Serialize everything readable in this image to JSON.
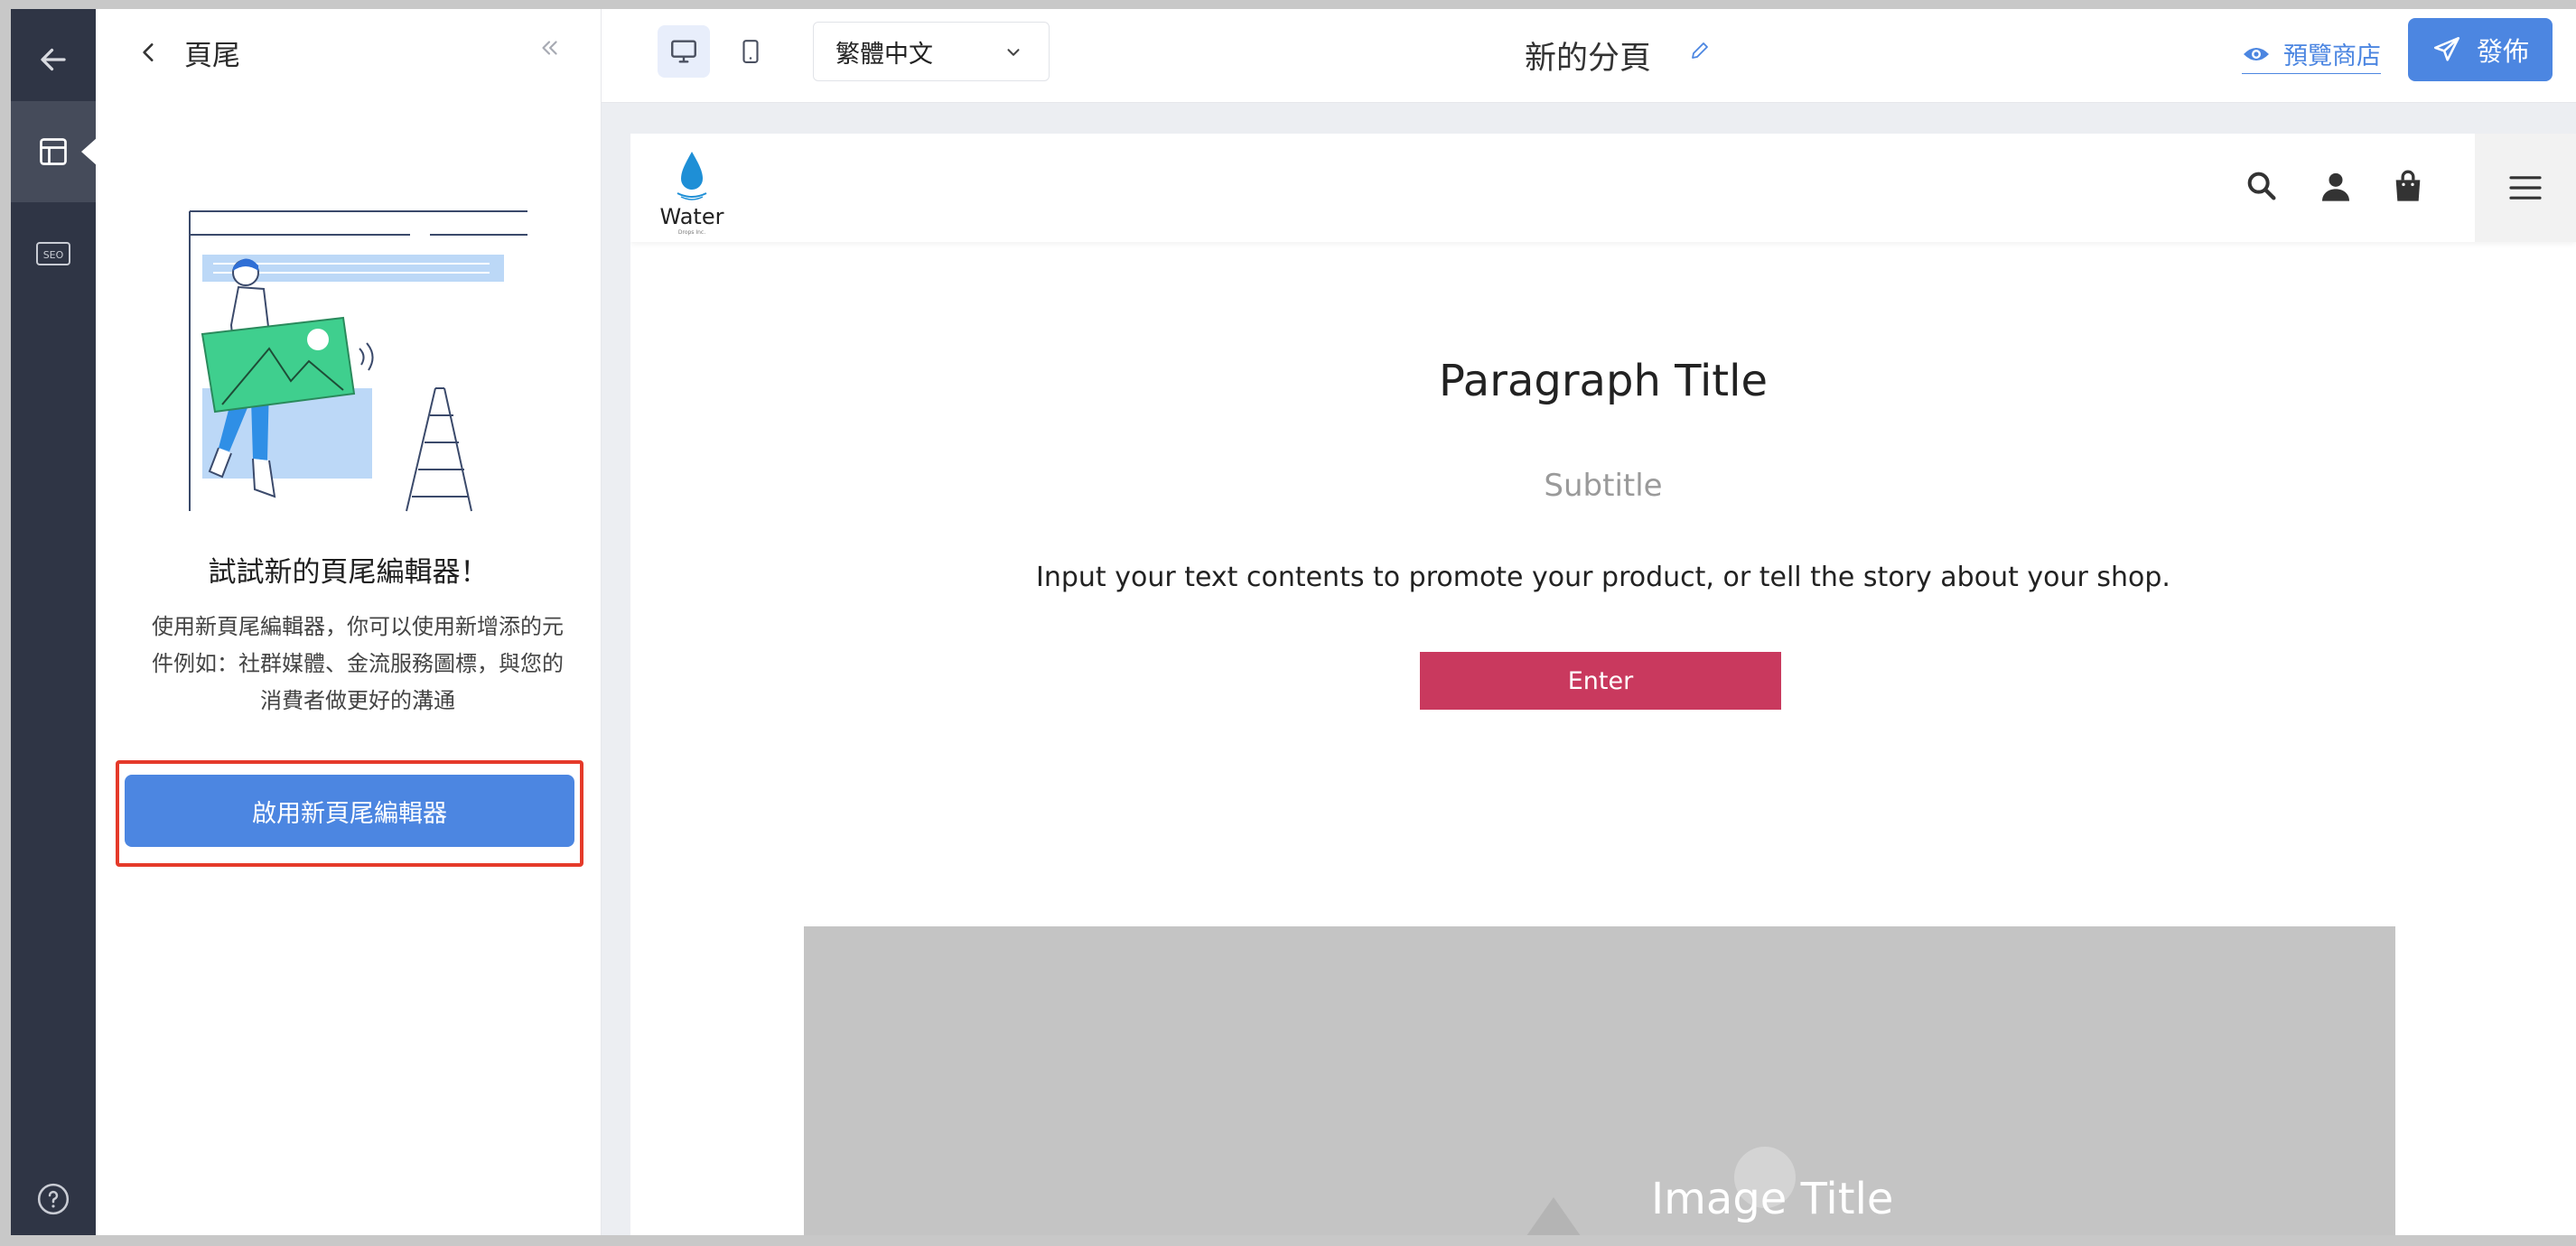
{
  "sidebar_rail": {
    "items": [
      {
        "name": "back"
      },
      {
        "name": "layout"
      },
      {
        "name": "seo",
        "label": "SEO"
      },
      {
        "name": "help"
      }
    ]
  },
  "side_panel": {
    "title": "頁尾",
    "promo_title": "試試新的頁尾編輯器！",
    "promo_desc_line1": "使用新頁尾編輯器，你可以使用新增添的元",
    "promo_desc_line2": "件例如：社群媒體、金流服務圖標，與您的",
    "promo_desc_line3": "消費者做更好的溝通",
    "enable_button": "啟用新頁尾編輯器"
  },
  "topbar": {
    "language": "繁體中文",
    "page_title": "新的分頁",
    "preview_label": "預覽商店",
    "publish_label": "發佈"
  },
  "preview": {
    "logo_text": "Water",
    "logo_sub": "Drops Inc.",
    "paragraph_title": "Paragraph Title",
    "subtitle": "Subtitle",
    "body": "Input your text contents to promote your product, or tell the story about your shop.",
    "button_label": "Enter",
    "image_title": "Image Title"
  },
  "colors": {
    "accent": "#4c86e1",
    "rail": "#2f3545",
    "cta": "#c9395e",
    "highlight": "#e53a2a"
  }
}
